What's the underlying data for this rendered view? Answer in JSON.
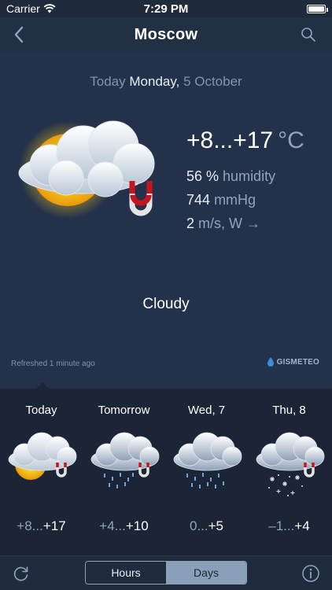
{
  "status_bar": {
    "carrier": "Carrier",
    "time": "7:29 PM"
  },
  "nav": {
    "title": "Moscow"
  },
  "current": {
    "date_today": "Today",
    "date_weekday": "Monday,",
    "date_day": "5 October",
    "temp_range": "+8...+17",
    "temp_unit": "°C",
    "humidity_value": "56 %",
    "humidity_label": "humidity",
    "pressure_value": "744",
    "pressure_unit": "mmHg",
    "wind_speed": "2",
    "wind_unit": "m/s, W →",
    "condition": "Cloudy",
    "icon": "sun-cloud-magnet-icon"
  },
  "footer": {
    "refreshed": "Refreshed 1 minute ago",
    "brand": "GISMETEO"
  },
  "forecast": [
    {
      "day": "Today",
      "temp_low": "+8...",
      "temp_high": "+17",
      "icon": "sun-cloud-magnet-icon"
    },
    {
      "day": "Tomorrow",
      "temp_low": "+4...",
      "temp_high": "+10",
      "icon": "rain-cloud-magnet-icon"
    },
    {
      "day": "Wed, 7",
      "temp_low": "0...",
      "temp_high": "+5",
      "icon": "rain-cloud-icon"
    },
    {
      "day": "Thu, 8",
      "temp_low": "–1...",
      "temp_high": "+4",
      "icon": "snow-cloud-magnet-icon"
    }
  ],
  "bottom": {
    "hours_label": "Hours",
    "days_label": "Days",
    "active": "Days"
  },
  "colors": {
    "background": "#1f2a3a",
    "panel": "#23324a",
    "dim_text": "#8fa4bd",
    "sun": "#f5c21b",
    "magnet_red": "#c4151c"
  }
}
